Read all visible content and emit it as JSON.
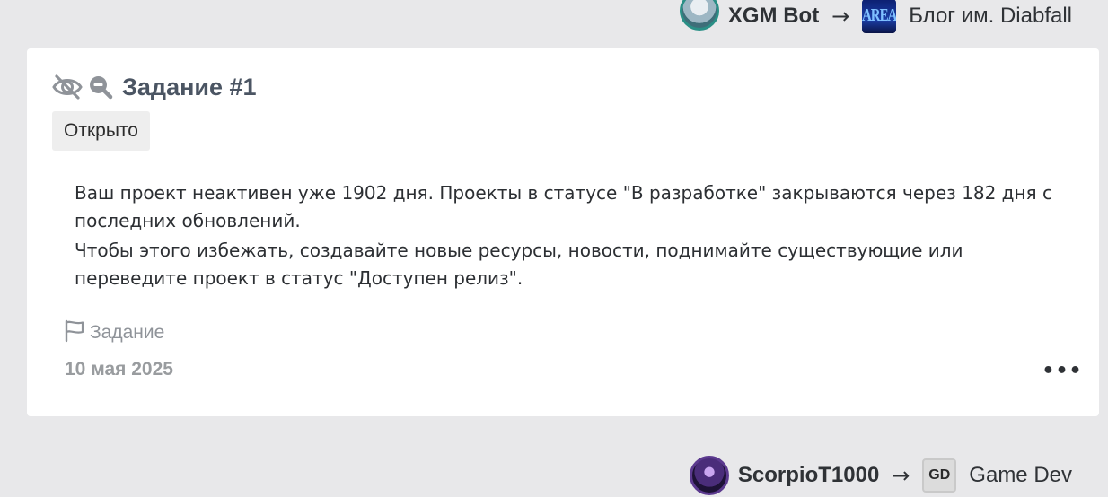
{
  "top_feed_header": {
    "author": "XGM Bot",
    "arrow": "→",
    "blog_name": "Блог им. Diabfall",
    "blog_thumb_text": "AREA"
  },
  "card": {
    "title": "Задание #1",
    "status": "Открыто",
    "body_paragraphs": [
      "Ваш проект неактивен уже 1902 дня. Проекты в статусе \"В разработке\" закрываются через 182 дня с последних обновлений.",
      "Чтобы этого избежать, создавайте новые ресурсы, новости, поднимайте существующие или переведите проект в статус \"Доступен релиз\"."
    ],
    "category": "Задание",
    "date": "10 мая 2025",
    "more": "•••"
  },
  "bottom_feed_header": {
    "author": "ScorpioT1000",
    "arrow": "→",
    "blog_name": "Game Dev",
    "blog_thumb_text": "GD"
  },
  "colors": {
    "page_bg": "#e8e8ea",
    "card_bg": "#ffffff",
    "title": "#4b5563",
    "muted": "#999c9f",
    "avatar_ring": "#2a8f86"
  },
  "icons": [
    "eye-slash-icon",
    "zoom-out-icon",
    "flag-icon",
    "ellipsis-icon"
  ]
}
